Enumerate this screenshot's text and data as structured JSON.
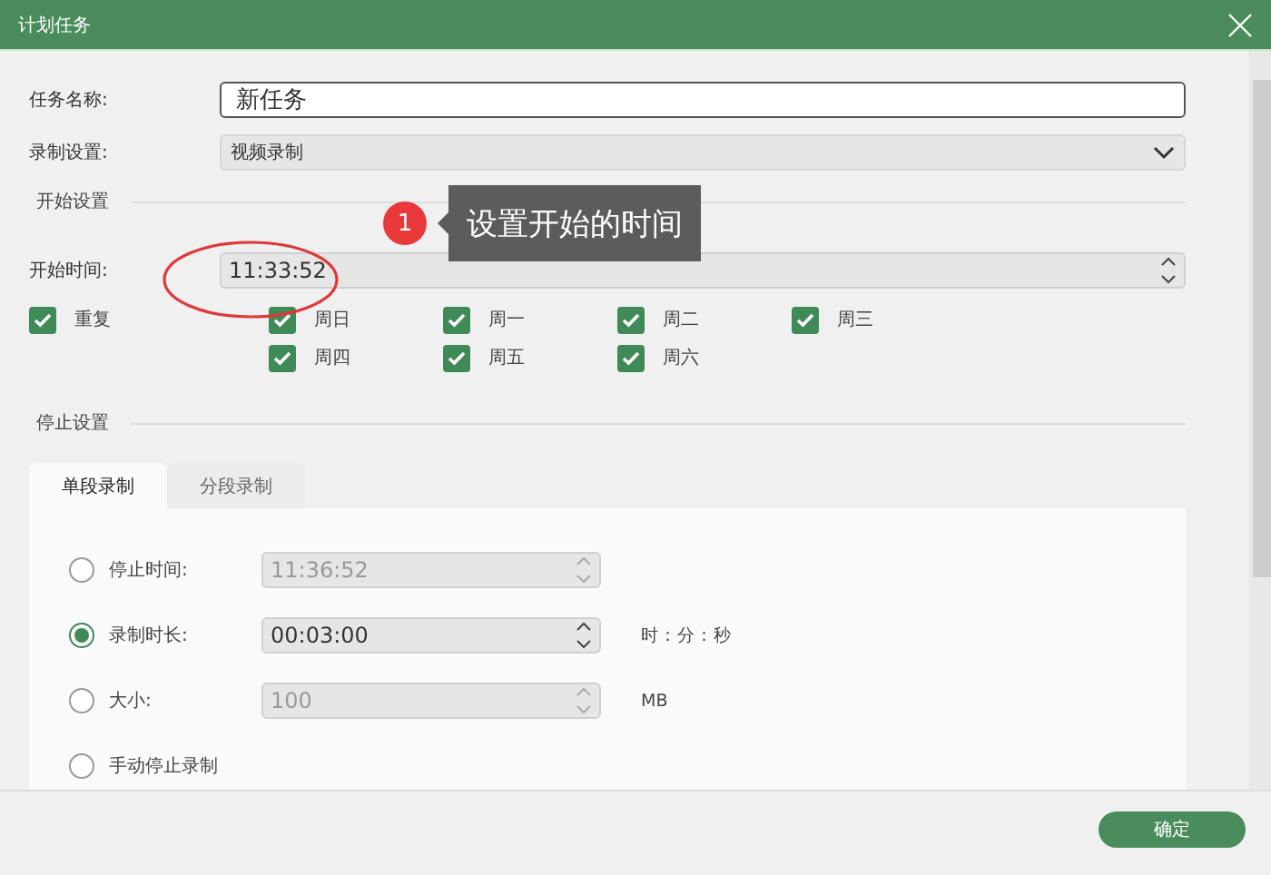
{
  "window": {
    "title": "计划任务"
  },
  "task_name": {
    "label": "任务名称:",
    "value": "新任务"
  },
  "record_setting": {
    "label": "录制设置:",
    "value": "视频录制"
  },
  "start_section": {
    "title": "开始设置"
  },
  "callout": {
    "number": "1",
    "text": "设置开始的时间"
  },
  "start_time": {
    "label": "开始时间:",
    "value": "11:33:52",
    "highlighted": true
  },
  "repeat": {
    "label": "重复",
    "checked": true
  },
  "days": [
    {
      "label": "周日",
      "checked": true
    },
    {
      "label": "周一",
      "checked": true
    },
    {
      "label": "周二",
      "checked": true
    },
    {
      "label": "周三",
      "checked": true
    },
    {
      "label": "周四",
      "checked": true
    },
    {
      "label": "周五",
      "checked": true
    },
    {
      "label": "周六",
      "checked": true
    }
  ],
  "stop_section": {
    "title": "停止设置"
  },
  "tabs": [
    {
      "label": "单段录制",
      "selected": true
    },
    {
      "label": "分段录制",
      "selected": false
    }
  ],
  "stop_options": [
    {
      "label": "停止时间:",
      "selected": false,
      "value": "11:36:52",
      "disabled": true
    },
    {
      "label": "录制时长:",
      "selected": true,
      "value": "00:03:00",
      "disabled": false,
      "unit": "时：分：秒"
    },
    {
      "label": "大小:",
      "selected": false,
      "value": "100",
      "disabled": true,
      "unit": "MB"
    },
    {
      "label": "手动停止录制",
      "selected": false
    }
  ],
  "buttons": [
    {
      "label": "确定"
    }
  ]
}
